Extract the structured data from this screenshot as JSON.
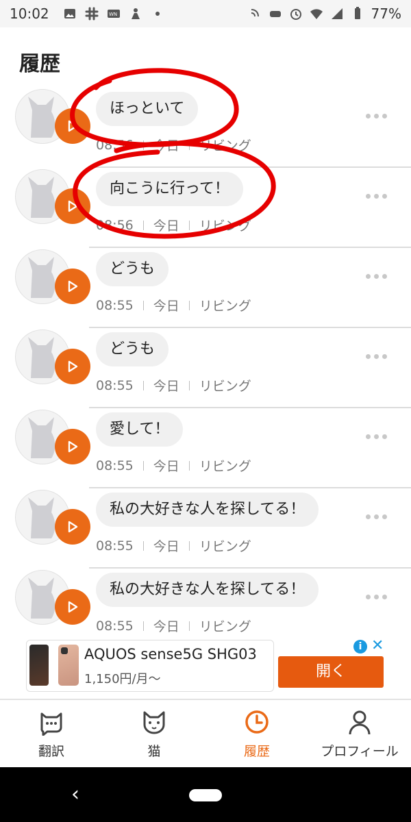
{
  "status_bar": {
    "time": "10:02",
    "battery": "77%",
    "left_icons": [
      "image-icon",
      "slack-icon",
      "weather-news-icon",
      "gesture-icon",
      "dot-icon"
    ],
    "right_icons": [
      "nfc-icon",
      "game-icon",
      "alarm-icon",
      "wifi-icon",
      "signal-icon",
      "battery-icon"
    ]
  },
  "header": {
    "title": "履歴"
  },
  "history": [
    {
      "text": "ほっといて",
      "time": "08:56",
      "day": "今日",
      "room": "リビング"
    },
    {
      "text": "向こうに行って！",
      "time": "08:56",
      "day": "今日",
      "room": "リビング"
    },
    {
      "text": "どうも",
      "time": "08:55",
      "day": "今日",
      "room": "リビング"
    },
    {
      "text": "どうも",
      "time": "08:55",
      "day": "今日",
      "room": "リビング"
    },
    {
      "text": "愛して！",
      "time": "08:55",
      "day": "今日",
      "room": "リビング"
    },
    {
      "text": "私の大好きな人を探してる！",
      "time": "08:55",
      "day": "今日",
      "room": "リビング"
    },
    {
      "text": "私の大好きな人を探してる！",
      "time": "08:55",
      "day": "今日",
      "room": "リビング"
    }
  ],
  "ad": {
    "title": "AQUOS sense5G SHG03",
    "subtitle": "1,150円/月〜",
    "open_label": "開く",
    "info_label": "i",
    "close_label": "✕"
  },
  "nav": {
    "items": [
      {
        "label": "翻訳",
        "icon": "chat-cat-icon",
        "active": false
      },
      {
        "label": "猫",
        "icon": "cat-face-icon",
        "active": false
      },
      {
        "label": "履歴",
        "icon": "clock-icon",
        "active": true
      },
      {
        "label": "プロフィール",
        "icon": "person-icon",
        "active": false
      }
    ]
  },
  "colors": {
    "accent": "#ea6a17",
    "annotation": "#e60000"
  }
}
